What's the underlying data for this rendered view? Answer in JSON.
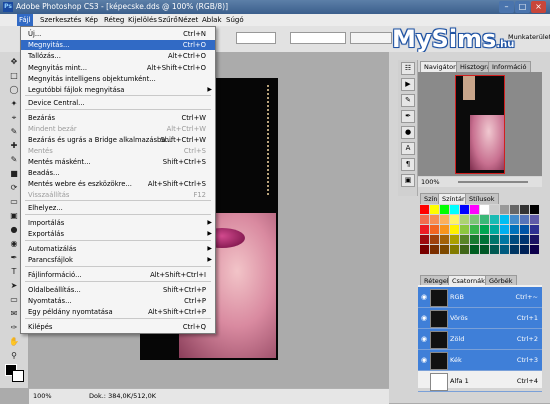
{
  "window": {
    "title": "Adobe Photoshop CS3 - [képecske.dds @ 100% (RGB/8)]",
    "icon": "photoshop-icon"
  },
  "menubar": {
    "items": [
      "Fájl",
      "Szerkesztés",
      "Kép",
      "Réteg",
      "Kijelölés",
      "Szűrő",
      "Nézet",
      "Ablak",
      "Súgó"
    ]
  },
  "options": {
    "workspace_label": "Munkaterület"
  },
  "logo": {
    "text": "MySims",
    "suffix": ".hu"
  },
  "file_menu": {
    "items": [
      {
        "label": "Új...",
        "shortcut": "Ctrl+N",
        "state": "normal"
      },
      {
        "label": "Megnyitás...",
        "shortcut": "Ctrl+O",
        "state": "highlighted"
      },
      {
        "label": "Tallózás...",
        "shortcut": "Alt+Ctrl+O",
        "state": "normal"
      },
      {
        "label": "Megnyitás mint...",
        "shortcut": "Alt+Shift+Ctrl+O",
        "state": "normal"
      },
      {
        "label": "Megnyitás intelligens objektumként...",
        "shortcut": "",
        "state": "normal"
      },
      {
        "label": "Legutóbbi fájlok megnyitása",
        "shortcut": "",
        "state": "submenu"
      },
      {
        "label": "Device Central...",
        "shortcut": "",
        "state": "normal"
      },
      {
        "label": "Bezárás",
        "shortcut": "Ctrl+W",
        "state": "normal"
      },
      {
        "label": "Mindent bezár",
        "shortcut": "Alt+Ctrl+W",
        "state": "disabled"
      },
      {
        "label": "Bezárás és ugrás a Bridge alkalmazásba...",
        "shortcut": "Shift+Ctrl+W",
        "state": "normal"
      },
      {
        "label": "Mentés",
        "shortcut": "Ctrl+S",
        "state": "disabled"
      },
      {
        "label": "Mentés másként...",
        "shortcut": "Shift+Ctrl+S",
        "state": "normal"
      },
      {
        "label": "Beadás...",
        "shortcut": "",
        "state": "normal"
      },
      {
        "label": "Mentés webre és eszközökre...",
        "shortcut": "Alt+Shift+Ctrl+S",
        "state": "normal"
      },
      {
        "label": "Visszaállítás",
        "shortcut": "F12",
        "state": "disabled"
      },
      {
        "label": "Elhelyez...",
        "shortcut": "",
        "state": "normal"
      },
      {
        "label": "Importálás",
        "shortcut": "",
        "state": "submenu"
      },
      {
        "label": "Exportálás",
        "shortcut": "",
        "state": "submenu"
      },
      {
        "label": "Automatizálás",
        "shortcut": "",
        "state": "submenu"
      },
      {
        "label": "Parancsfájlok",
        "shortcut": "",
        "state": "submenu"
      },
      {
        "label": "Fájlinformáció...",
        "shortcut": "Alt+Shift+Ctrl+I",
        "state": "normal"
      },
      {
        "label": "Oldalbeállítás...",
        "shortcut": "Shift+Ctrl+P",
        "state": "normal"
      },
      {
        "label": "Nyomtatás...",
        "shortcut": "Ctrl+P",
        "state": "normal"
      },
      {
        "label": "Egy példány nyomtatása",
        "shortcut": "Alt+Shift+Ctrl+P",
        "state": "normal"
      },
      {
        "label": "Kilépés",
        "shortcut": "Ctrl+Q",
        "state": "normal"
      }
    ]
  },
  "navigator": {
    "tabs": [
      "Navigátor",
      "Hisztogram",
      "Információ"
    ],
    "zoom": "100%"
  },
  "color_panel": {
    "tabs": [
      "Szín",
      "Színtár",
      "Stílusok"
    ]
  },
  "layers_panel": {
    "tabs": [
      "Rétegek",
      "Csatornák",
      "Görbék"
    ],
    "channels": [
      {
        "name": "RGB",
        "shortcut": "Ctrl+~",
        "selected": true
      },
      {
        "name": "Vörös",
        "shortcut": "Ctrl+1",
        "selected": true
      },
      {
        "name": "Zöld",
        "shortcut": "Ctrl+2",
        "selected": true
      },
      {
        "name": "Kék",
        "shortcut": "Ctrl+3",
        "selected": true
      },
      {
        "name": "Alfa 1",
        "shortcut": "Ctrl+4",
        "selected": false
      }
    ]
  },
  "status": {
    "zoom": "100%",
    "doc_info": "Dok.: 384,0K/512,0K"
  },
  "swatch_colors": [
    "#ff0000",
    "#ffff00",
    "#00ff00",
    "#00ffff",
    "#0000ff",
    "#ff00ff",
    "#ffffff",
    "#cccccc",
    "#999999",
    "#666666",
    "#333333",
    "#000000",
    "#f26c4f",
    "#f68e55",
    "#fbaf5c",
    "#fff467",
    "#acd372",
    "#7cc576",
    "#3bb878",
    "#1abbb4",
    "#00bff3",
    "#438ccb",
    "#5574b9",
    "#605ca8",
    "#ed1c24",
    "#f26522",
    "#f7941d",
    "#fff200",
    "#8dc73f",
    "#39b54a",
    "#00a651",
    "#00a99d",
    "#00aeef",
    "#0072bc",
    "#0054a6",
    "#2e3192",
    "#9e0b0f",
    "#a0410d",
    "#a36209",
    "#aba000",
    "#598527",
    "#1a7b30",
    "#007236",
    "#00746b",
    "#0076a3",
    "#004b80",
    "#003471",
    "#1b1464",
    "#790000",
    "#7b2e00",
    "#7d4900",
    "#827b00",
    "#406618",
    "#005e20",
    "#005826",
    "#005952",
    "#005b7f",
    "#003663",
    "#002157",
    "#0d004c"
  ]
}
